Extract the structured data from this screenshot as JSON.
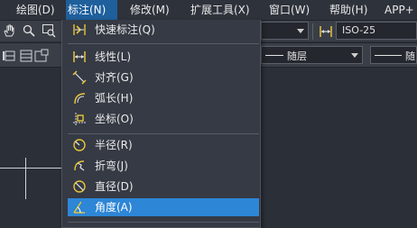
{
  "menubar": {
    "items": [
      {
        "label": "绘图(D)"
      },
      {
        "label": "标注(N)"
      },
      {
        "label": "修改(M)"
      },
      {
        "label": "扩展工具(X)"
      },
      {
        "label": "窗口(W)"
      },
      {
        "label": "帮助(H)"
      },
      {
        "label": "APP+"
      }
    ]
  },
  "toolbar": {
    "dimstyle_value": "ISO-25",
    "layer_value": "随层",
    "linetype_value": "随"
  },
  "dim_menu": {
    "items": [
      {
        "label": "快速标注(Q)",
        "icon": "quick-dimension-icon"
      },
      {
        "label": "线性(L)",
        "icon": "linear-dimension-icon"
      },
      {
        "label": "对齐(G)",
        "icon": "aligned-dimension-icon"
      },
      {
        "label": "弧长(H)",
        "icon": "arc-length-icon"
      },
      {
        "label": "坐标(O)",
        "icon": "ordinate-dimension-icon"
      },
      {
        "label": "半径(R)",
        "icon": "radius-dimension-icon"
      },
      {
        "label": "折弯(J)",
        "icon": "jogged-dimension-icon"
      },
      {
        "label": "直径(D)",
        "icon": "diameter-dimension-icon"
      },
      {
        "label": "角度(A)",
        "icon": "angular-dimension-icon"
      }
    ],
    "highlight_color": "#2d86d6"
  },
  "colors": {
    "menubar_active": "#1e5f9c",
    "icon_yellow": "#e8c53a",
    "background": "#2b2f38"
  }
}
